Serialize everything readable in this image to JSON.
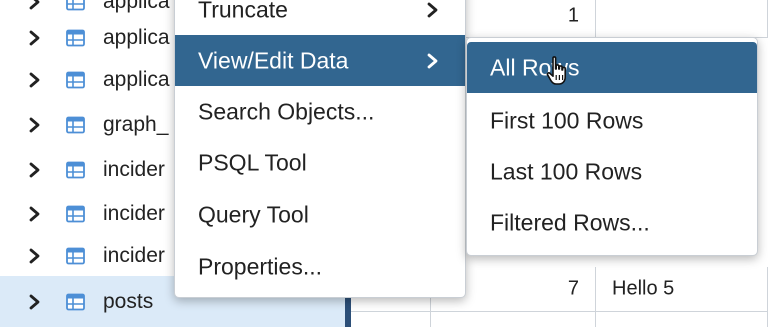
{
  "tree": {
    "items": [
      {
        "label": "applica",
        "selected": false
      },
      {
        "label": "applica",
        "selected": false
      },
      {
        "label": "applica",
        "selected": false
      },
      {
        "label": "graph_",
        "selected": false
      },
      {
        "label": "incider",
        "selected": false
      },
      {
        "label": "incider",
        "selected": false
      },
      {
        "label": "incider",
        "selected": false
      },
      {
        "label": "posts",
        "selected": true
      }
    ]
  },
  "grid": {
    "visible_rows": [
      {
        "id": "1",
        "text": ""
      },
      {
        "id": "7",
        "text": "Hello 5"
      }
    ]
  },
  "context_menu": {
    "items": [
      {
        "label": "Truncate",
        "has_submenu": true
      },
      {
        "label": "View/Edit Data",
        "has_submenu": true,
        "active": true
      },
      {
        "label": "Search Objects...",
        "has_submenu": false
      },
      {
        "label": "PSQL Tool",
        "has_submenu": false
      },
      {
        "label": "Query Tool",
        "has_submenu": false
      },
      {
        "label": "Properties...",
        "has_submenu": false
      }
    ]
  },
  "submenu": {
    "items": [
      {
        "label": "All Rows",
        "active": true
      },
      {
        "label": "First 100 Rows"
      },
      {
        "label": "Last 100 Rows"
      },
      {
        "label": "Filtered Rows..."
      }
    ]
  },
  "icons": {
    "tree_expand": "chevron-right-icon",
    "table": "table-icon",
    "submenu_arrow": "chevron-right-icon",
    "cursor": "hand-pointer-icon"
  },
  "colors": {
    "menu_active_bg": "#326690",
    "tree_selected_bg": "#dbeaf8",
    "table_icon": "#4d8fd6",
    "panel_divider": "#2c4f78"
  }
}
